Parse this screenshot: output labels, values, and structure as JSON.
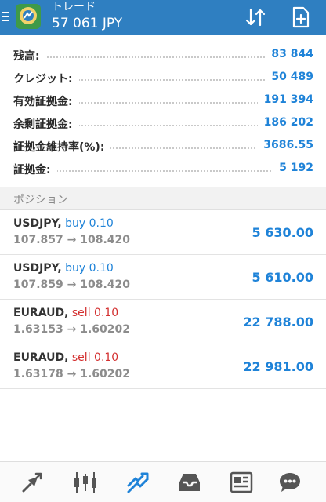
{
  "header": {
    "title": "トレード",
    "subtitle": "57 061 JPY",
    "colors": {
      "bar": "#2f7fc1",
      "accent": "#1f83d8",
      "buy": "#1f83d8",
      "sell": "#d32f2f"
    },
    "icons": {
      "menu": "menu-icon",
      "logo": "app-logo",
      "sort": "sort-icon",
      "new_order": "new-order-icon"
    }
  },
  "summary": [
    {
      "label": "残高:",
      "value": "83 844"
    },
    {
      "label": "クレジット:",
      "value": "50 489"
    },
    {
      "label": "有効証拠金:",
      "value": "191 394"
    },
    {
      "label": "余剰証拠金:",
      "value": "186 202"
    },
    {
      "label": "証拠金維持率(%):",
      "value": "3686.55"
    },
    {
      "label": "証拠金:",
      "value": "5 192"
    }
  ],
  "positions_header": "ポジション",
  "positions": [
    {
      "symbol": "USDJPY,",
      "side": "buy",
      "volume": "0.10",
      "prices": "107.857 → 108.420",
      "profit": "5 630.00"
    },
    {
      "symbol": "USDJPY,",
      "side": "buy",
      "volume": "0.10",
      "prices": "107.859 → 108.420",
      "profit": "5 610.00"
    },
    {
      "symbol": "EURAUD,",
      "side": "sell",
      "volume": "0.10",
      "prices": "1.63153 → 1.60202",
      "profit": "22 788.00"
    },
    {
      "symbol": "EURAUD,",
      "side": "sell",
      "volume": "0.10",
      "prices": "1.63178 → 1.60202",
      "profit": "22 981.00"
    }
  ],
  "bottom_nav": [
    "quotes-icon",
    "chart-icon",
    "trade-icon",
    "history-icon",
    "news-icon",
    "chat-icon"
  ]
}
